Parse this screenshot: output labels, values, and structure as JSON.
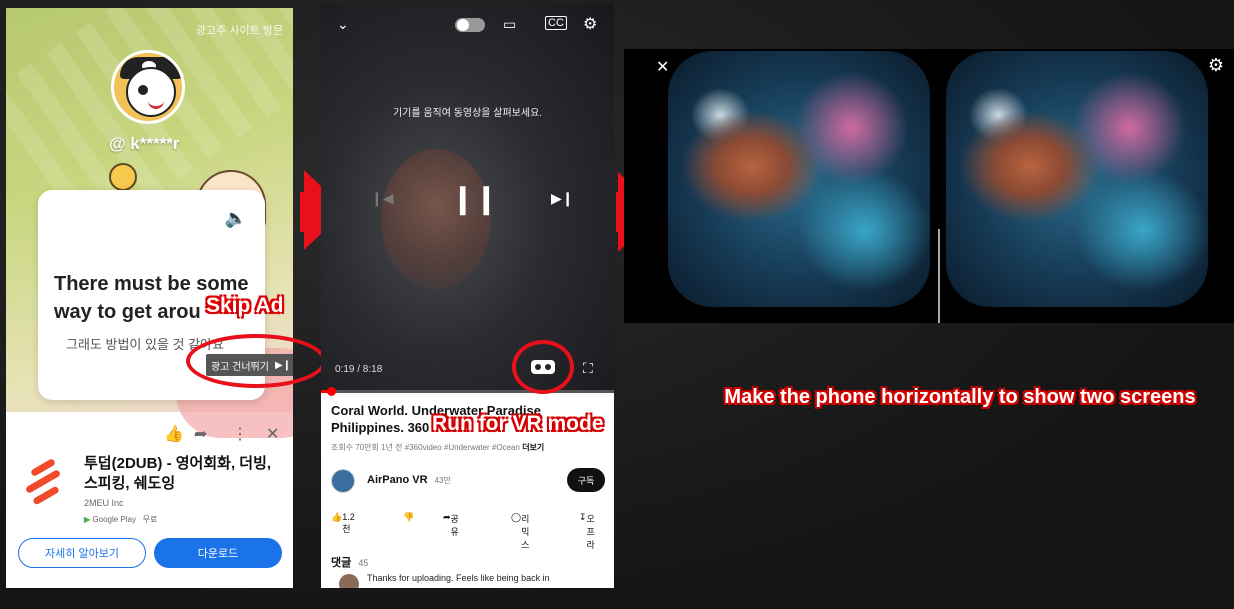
{
  "panel1": {
    "ad_link": "광고주 사이트 방문",
    "handle": "@ k*****r",
    "card_title": "There must be some way to get arou",
    "card_subtitle": "그래도 방법이 있을 것 같아요",
    "skip_button": "광고 건너뛰기",
    "app_name": "투덥(2DUB) - 영어회화, 더빙, 스피킹, 쉐도잉",
    "publisher": "2MEU Inc",
    "store": "Google Play",
    "price": "무료",
    "btn_more": "자세히 알아보기",
    "btn_download": "다운로드",
    "annotation": "Skip Ad"
  },
  "panel2": {
    "hint": "기기를 움직여 동영상을 살펴보세요.",
    "time": "0:19 / 8:18",
    "progress_fraction": 0.04,
    "title": "Coral World. Underwater Paradise Philippines. 360",
    "meta": "조회수 70만회  1년 전  #360video  #Underwater  #Ocean",
    "meta_more": "더보기",
    "channel": "AirPano VR",
    "subs": "43만",
    "subscribe": "구독",
    "likes": "1.2천",
    "share": "공유",
    "remix": "리믹스",
    "offline": "오프라",
    "comments_label": "댓글",
    "comments_count": "45",
    "comment": "Thanks for uploading. Feels like being back in",
    "annotation": "Run for VR mode"
  },
  "panel3": {
    "caption": "Make the phone horizontally to show two screens"
  },
  "colors": {
    "annotation_red": "#e8101a",
    "youtube_blue": "#1a73e8"
  }
}
